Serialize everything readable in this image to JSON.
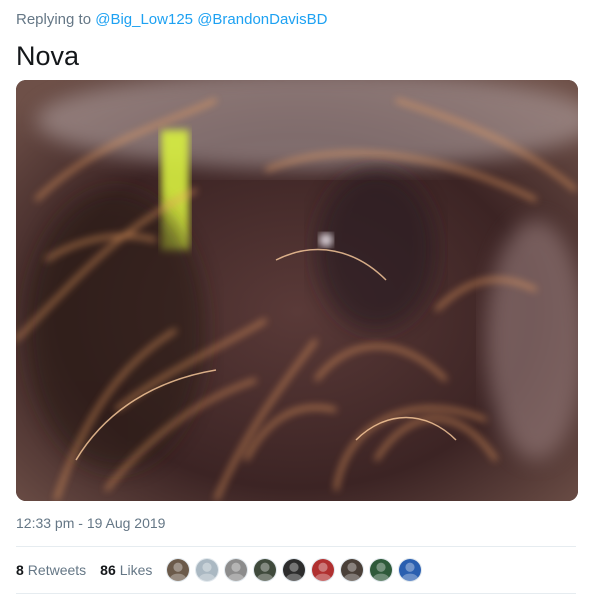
{
  "reply": {
    "prefix": "Replying to",
    "mentions": [
      "@Big_Low125",
      "@BrandonDavisBD"
    ]
  },
  "tweet": {
    "text": "Nova",
    "timestamp": "12:33 pm - 19 Aug 2019"
  },
  "stats": {
    "retweets_count": "8",
    "retweets_label": "Retweets",
    "likes_count": "86",
    "likes_label": "Likes"
  },
  "likers": [
    {
      "name": "avatar-1",
      "color": "#6b5a4a"
    },
    {
      "name": "avatar-2",
      "color": "#aab8c2"
    },
    {
      "name": "avatar-3",
      "color": "#8c8c8c"
    },
    {
      "name": "avatar-4",
      "color": "#3f4a3c"
    },
    {
      "name": "avatar-5",
      "color": "#2c2c2c"
    },
    {
      "name": "avatar-6",
      "color": "#b03030"
    },
    {
      "name": "avatar-7",
      "color": "#4a4038"
    },
    {
      "name": "avatar-8",
      "color": "#2f5a3a"
    },
    {
      "name": "avatar-9",
      "color": "#2a5fb0"
    }
  ],
  "colors": {
    "link": "#1da1f2",
    "muted": "#657786",
    "text": "#14171a"
  }
}
